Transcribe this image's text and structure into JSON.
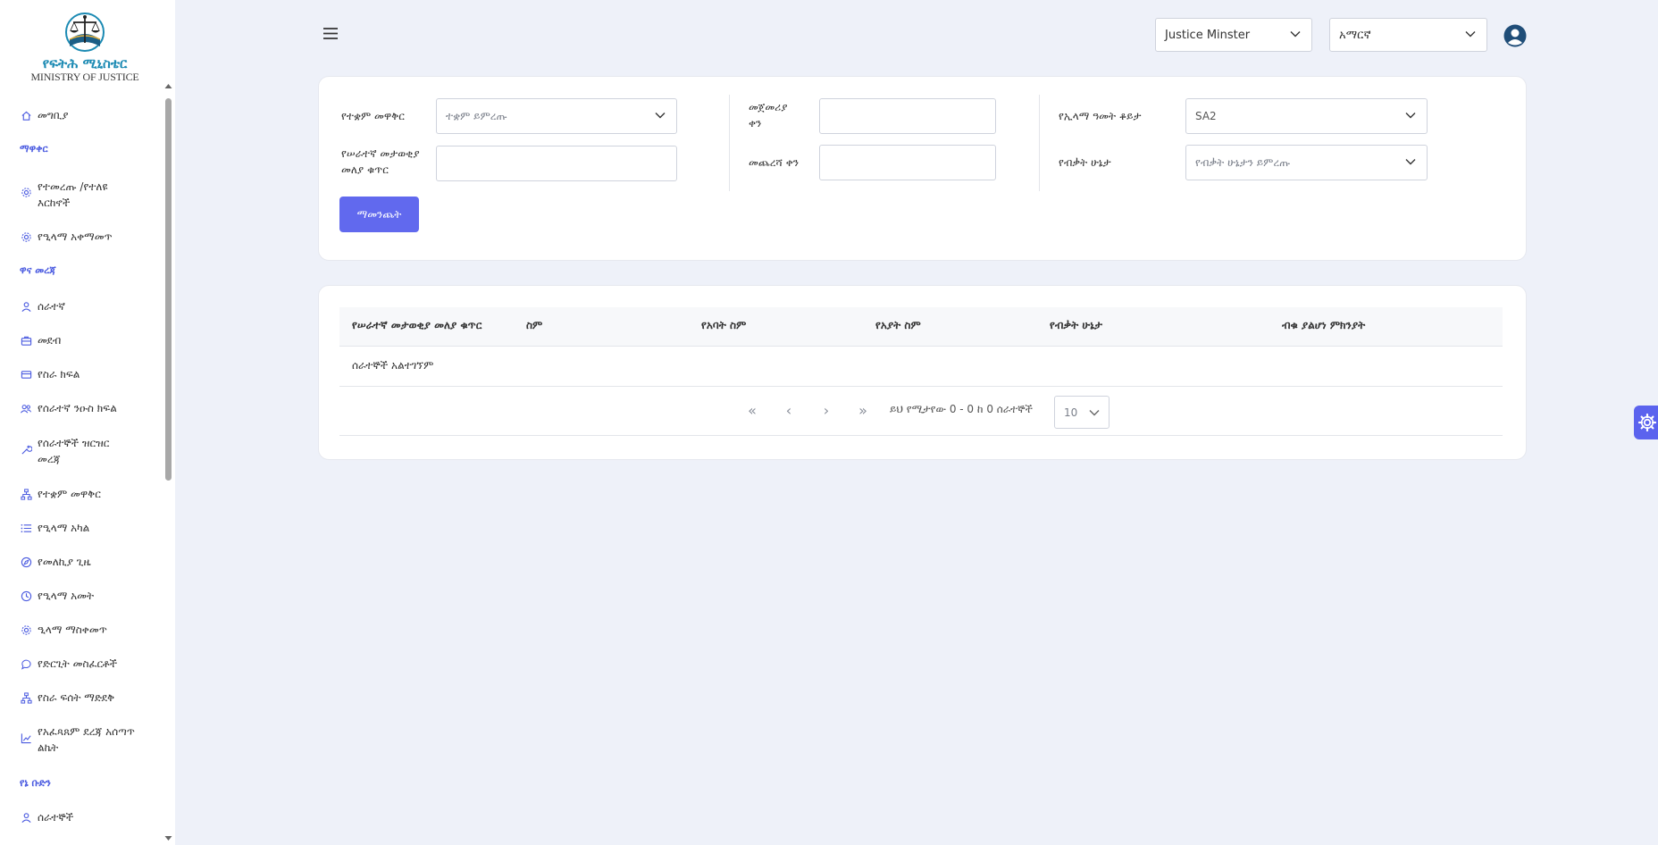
{
  "logo": {
    "amharic": "የፍትሕ ሚኒስቴር",
    "english": "MINISTRY OF JUSTICE"
  },
  "sidebar": {
    "items": [
      {
        "label": "መግቢያ",
        "icon": "home-icon"
      },
      {
        "label": "ማዋቀር",
        "section": true
      },
      {
        "label": "የተመረጡ /የተለዩ እርከኖች",
        "icon": "gear-icon"
      },
      {
        "label": "የዒላማ አቀማመጥ",
        "icon": "gear-icon"
      },
      {
        "label": "ዋና መረጃ",
        "section": true
      },
      {
        "label": "ሰራተኛ",
        "icon": "user-icon"
      },
      {
        "label": "መደብ",
        "icon": "briefcase-icon"
      },
      {
        "label": "የስራ ክፍል",
        "icon": "card-icon"
      },
      {
        "label": "የሰራተኛ ንዑስ ክፍል",
        "icon": "users-icon"
      },
      {
        "label": "የሰራተኞች ዝርዝር መረጃ",
        "icon": "tool-icon"
      },
      {
        "label": "የተቋም መዋቅር",
        "icon": "sitemap-icon"
      },
      {
        "label": "የዒላማ አካል",
        "icon": "list-icon"
      },
      {
        "label": "የመለኪያ ጊዜ",
        "icon": "compass-icon"
      },
      {
        "label": "የዒላማ አመት",
        "icon": "clock-icon"
      },
      {
        "label": "ዒላማ ማስቀመጥ",
        "icon": "gear-icon"
      },
      {
        "label": "የድርጊት መስፈርቶች",
        "icon": "chat-icon"
      },
      {
        "label": "የስራ ፍሰት ማድደቅ",
        "icon": "sitemap-icon"
      },
      {
        "label": "የአፈጻጸም ደረጃ አሰጣጥ ልኬት",
        "icon": "chart-icon"
      },
      {
        "label": "የኔ ቡድን",
        "section": true
      },
      {
        "label": "ሰራተኞች",
        "icon": "user-icon"
      }
    ]
  },
  "topbar": {
    "role_select": "Justice Minster",
    "language_select": "አማርኛ"
  },
  "filters": {
    "institution_label": "የተቋም መዋቅር",
    "institution_placeholder": "ተቋም ይምረጡ",
    "employee_id_label": "የሠራተኛ መታወቂያ መለያ ቁጥር",
    "employee_id_value": "",
    "start_date_label": "መጀመሪያ ቀን",
    "start_date_value": "",
    "end_date_label": "መጨረሻ ቀን",
    "end_date_value": "",
    "target_year_label": "የኢላማ ዓመት ቆይታ",
    "target_year_value": "SA2",
    "eligibility_label": "የብቃት ሁኔታ",
    "eligibility_placeholder": "የብቃት ሁኔታን ይምረጡ",
    "filter_button": "ማመንጨት"
  },
  "table": {
    "columns": [
      "የሠራተኛ መታወቂያ መለያ ቁጥር",
      "ስም",
      "የአባት ስም",
      "የአያት ስም",
      "የብቃት ሁኔታ",
      "ብቁ ያልሆነ ምክንያት"
    ],
    "empty_message": "ሰራተኞች አልተገኘም",
    "pagination": {
      "first": "«",
      "prev": "‹",
      "next": "›",
      "last": "»",
      "info": "ይህ የሚታየው 0 - 0 ከ 0 ሰራተኞች",
      "page_size": "10"
    }
  },
  "colors": {
    "accent": "#6169ee",
    "section": "#4b5be0",
    "logo_text": "#1b8ab3",
    "background": "#eef1f9"
  }
}
